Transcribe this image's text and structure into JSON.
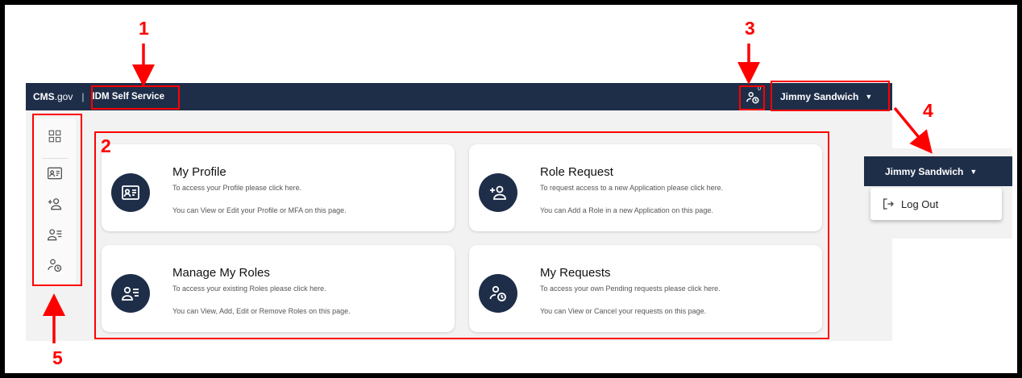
{
  "header": {
    "brand_main": "CMS",
    "brand_suffix": ".gov",
    "separator": "|",
    "app_name": "IDM Self Service",
    "notification_count": "0",
    "user_name": "Jimmy Sandwich",
    "caret": "▼"
  },
  "sidebar": {
    "items": [
      {
        "icon": "dashboard-grid-icon"
      },
      {
        "icon": "profile-card-icon"
      },
      {
        "icon": "add-person-icon"
      },
      {
        "icon": "person-list-icon"
      },
      {
        "icon": "person-clock-icon"
      }
    ]
  },
  "cards": [
    {
      "title": "My Profile",
      "line1": "To access your Profile please click here.",
      "line2": "You can View or Edit your Profile or MFA on this page.",
      "icon": "profile-card-icon"
    },
    {
      "title": "Role Request",
      "line1": "To request access to a new Application please click here.",
      "line2": "You can Add a Role in a new Application on this page.",
      "icon": "add-person-icon"
    },
    {
      "title": "Manage My Roles",
      "line1": "To access your existing Roles please click here.",
      "line2": "You can View, Add, Edit or Remove Roles on this page.",
      "icon": "person-list-icon"
    },
    {
      "title": "My Requests",
      "line1": "To access your own Pending requests please click here.",
      "line2": "You can View or Cancel your requests on this page.",
      "icon": "person-clock-icon"
    }
  ],
  "user_menu": {
    "user_name": "Jimmy Sandwich",
    "caret": "▼",
    "logout_label": "Log Out"
  },
  "annotations": {
    "n1": "1",
    "n2": "2",
    "n3": "3",
    "n4": "4",
    "n5": "5",
    "color": "#ff0000"
  },
  "colors": {
    "navy": "#1e2e49",
    "page_bg": "#f2f2f2"
  }
}
